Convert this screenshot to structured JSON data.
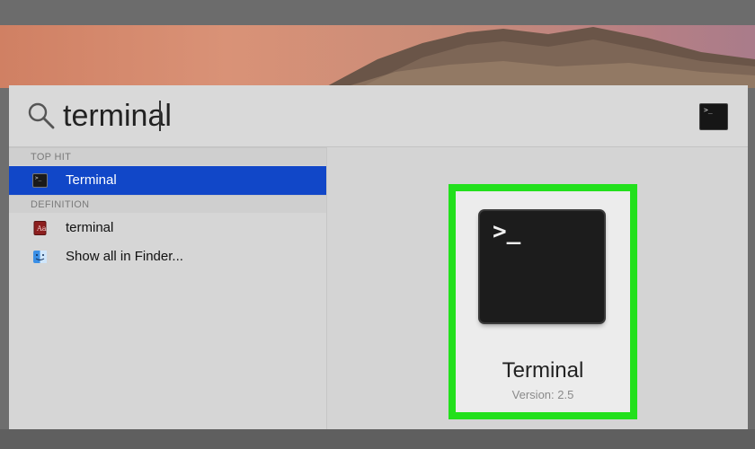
{
  "search": {
    "query": "terminal"
  },
  "results": {
    "sections": [
      {
        "header": "TOP HIT",
        "items": [
          {
            "label": "Terminal",
            "icon": "terminal-app-icon",
            "selected": true
          }
        ]
      },
      {
        "header": "DEFINITION",
        "items": [
          {
            "label": "terminal",
            "icon": "dictionary-icon",
            "selected": false
          },
          {
            "label": "Show all in Finder...",
            "icon": "finder-icon",
            "selected": false
          }
        ]
      }
    ]
  },
  "preview": {
    "title": "Terminal",
    "version": "Version: 2.5",
    "prompt_glyph": ">_",
    "highlight_color": "#22e01c"
  },
  "colors": {
    "selection": "#1147c8",
    "panel": "#d6d6d6"
  }
}
